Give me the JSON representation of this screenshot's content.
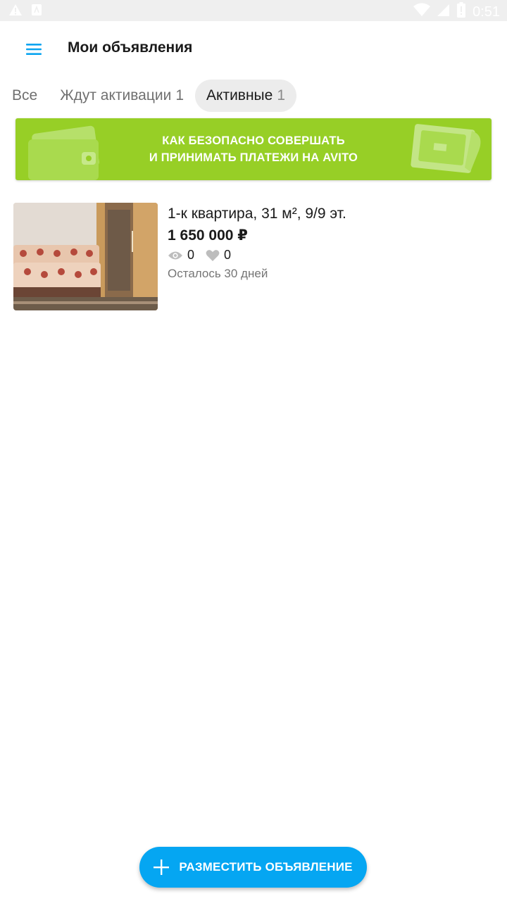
{
  "status_bar": {
    "time": "0:51",
    "icons": [
      "warning-icon",
      "android-icon",
      "wifi-icon",
      "signal-icon",
      "battery-icon"
    ]
  },
  "header": {
    "title": "Мои объявления",
    "menu_icon": "hamburger-menu-icon"
  },
  "tabs": [
    {
      "label": "Все",
      "count": "",
      "active": false
    },
    {
      "label": "Ждут активации",
      "count": "1",
      "active": false
    },
    {
      "label": "Активные",
      "count": "1",
      "active": true
    }
  ],
  "banner": {
    "line1": "КАК БЕЗОПАСНО СОВЕРШАТЬ",
    "line2": "И ПРИНИМАТЬ ПЛАТЕЖИ НА AVITO",
    "color": "#97cf26"
  },
  "listings": [
    {
      "title": "1-к квартира, 31 м², 9/9 эт.",
      "price": "1 650 000 ₽",
      "views": "0",
      "favorites": "0",
      "days_left": "Осталось 30 дней"
    }
  ],
  "fab": {
    "label": "РАЗМЕСТИТЬ ОБЪЯВЛЕНИЕ",
    "icon": "plus-icon",
    "color": "#05a6f2"
  }
}
